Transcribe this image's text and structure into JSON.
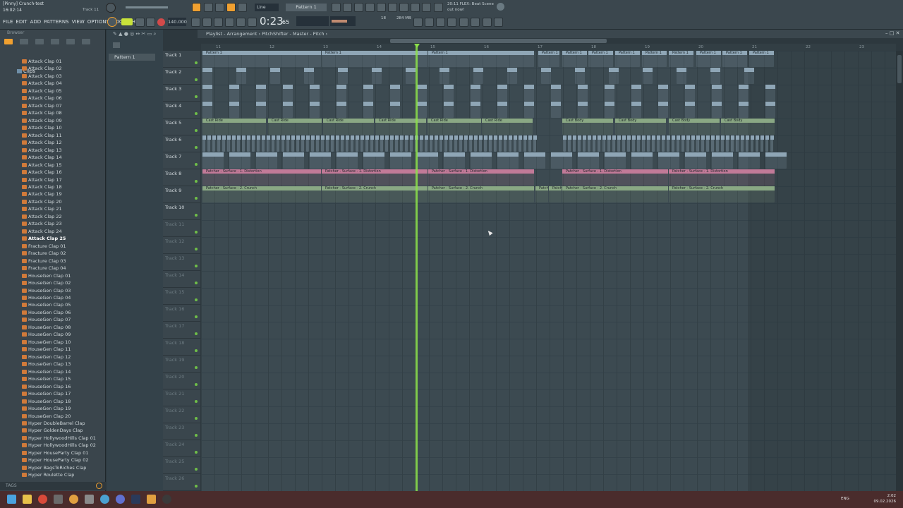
{
  "title": {
    "file": "[Pinny] Crunch-test",
    "time": "16:02:14",
    "track": "Track 11"
  },
  "transport": {
    "time": "0:23",
    "time_ms": "65",
    "tempo": "140.000",
    "snap": "Line",
    "pattern": "Pattern 1",
    "mem": "284 MB",
    "cpu": "18"
  },
  "hint": {
    "line1": "20:11  FLEX: Beat Scene",
    "line2": "out now!"
  },
  "menu": [
    "FILE",
    "EDIT",
    "ADD",
    "PATTERNS",
    "VIEW",
    "OPTIONS",
    "TOOLS",
    "HELP"
  ],
  "browser": {
    "heading": "Browser",
    "root": "Clips",
    "items": [
      "Attack Clap 01",
      "Attack Clap 02",
      "Attack Clap 03",
      "Attack Clap 04",
      "Attack Clap 05",
      "Attack Clap 06",
      "Attack Clap 07",
      "Attack Clap 08",
      "Attack Clap 09",
      "Attack Clap 10",
      "Attack Clap 11",
      "Attack Clap 12",
      "Attack Clap 13",
      "Attack Clap 14",
      "Attack Clap 15",
      "Attack Clap 16",
      "Attack Clap 17",
      "Attack Clap 18",
      "Attack Clap 19",
      "Attack Clap 20",
      "Attack Clap 21",
      "Attack Clap 22",
      "Attack Clap 23",
      "Attack Clap 24",
      "Attack Clap 25",
      "Fracture Clap 01",
      "Fracture Clap 02",
      "Fracture Clap 03",
      "Fracture Clap 04",
      "HouseGen Clap 01",
      "HouseGen Clap 02",
      "HouseGen Clap 03",
      "HouseGen Clap 04",
      "HouseGen Clap 05",
      "HouseGen Clap 06",
      "HouseGen Clap 07",
      "HouseGen Clap 08",
      "HouseGen Clap 09",
      "HouseGen Clap 10",
      "HouseGen Clap 11",
      "HouseGen Clap 12",
      "HouseGen Clap 13",
      "HouseGen Clap 14",
      "HouseGen Clap 15",
      "HouseGen Clap 16",
      "HouseGen Clap 17",
      "HouseGen Clap 18",
      "HouseGen Clap 19",
      "HouseGen Clap 20",
      "Hyper DoubleBarrel Clap",
      "Hyper GoldenDays Clap",
      "Hyper HollywoodHills Clap 01",
      "Hyper HollywoodHills Clap 02",
      "Hyper HouseParty Clap 01",
      "Hyper HouseParty Clap 02",
      "Hyper BagsToRiches Clap",
      "Hyper Roulette Clap"
    ],
    "selected_index": 24,
    "tags_label": "TAGS"
  },
  "picker": {
    "item": "Pattern 1"
  },
  "playlist": {
    "title": "Playlist - Arrangement › PitchShifter - Master - Pitch ›",
    "ruler": [
      "11",
      "12",
      "13",
      "14",
      "15",
      "16",
      "17",
      "18",
      "19",
      "20",
      "21",
      "22",
      "23"
    ],
    "tracks": [
      "Track 1",
      "Track 2",
      "Track 3",
      "Track 4",
      "Track 5",
      "Track 6",
      "Track 7",
      "Track 8",
      "Track 9",
      "Track 10",
      "Track 11",
      "Track 12",
      "Track 13",
      "Track 14",
      "Track 15",
      "Track 16",
      "Track 17",
      "Track 18",
      "Track 19",
      "Track 20",
      "Track 21",
      "Track 22",
      "Track 23",
      "Track 24",
      "Track 25",
      "Track 26"
    ],
    "clip_labels": {
      "pattern": "Pattern 1",
      "cast_ride": "Cast Ride",
      "cast_body": "Cast Body",
      "distortion": "Patcher - Surface - 1. Distortion",
      "crunch": "Patcher - Surface - 2. Crunch"
    }
  },
  "colors": {
    "accent": "#f0a030",
    "playhead": "#8ce04a",
    "clip_green": "#8aa884",
    "clip_pink": "#c27a98",
    "clip_blue": "#8fa6b6"
  },
  "taskbar": {
    "lang": "ENG",
    "time": "2:02",
    "date": "09.02.2026"
  }
}
